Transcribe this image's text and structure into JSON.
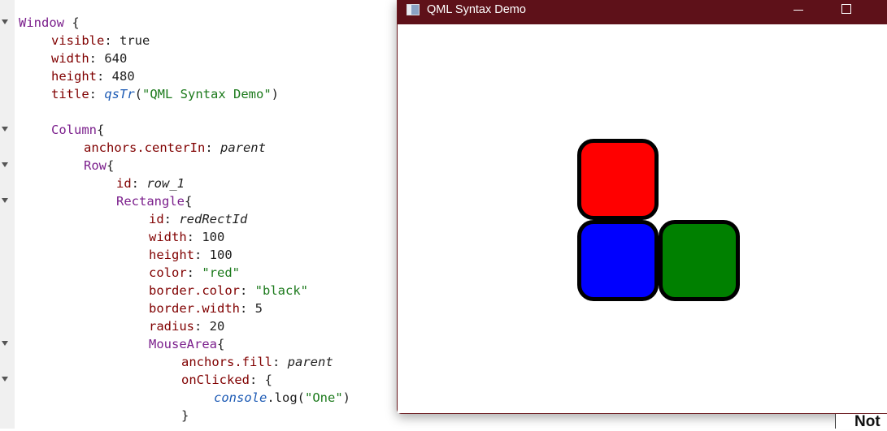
{
  "editor": {
    "lines": [
      {
        "fold": true,
        "indent": 0,
        "tokens": [
          {
            "c": "type",
            "t": "Window"
          },
          {
            "c": "plain",
            "t": " {"
          }
        ]
      },
      {
        "fold": false,
        "indent": 1,
        "tokens": [
          {
            "c": "prop",
            "t": "visible"
          },
          {
            "c": "plain",
            "t": ": true"
          }
        ]
      },
      {
        "fold": false,
        "indent": 1,
        "tokens": [
          {
            "c": "prop",
            "t": "width"
          },
          {
            "c": "plain",
            "t": ": 640"
          }
        ]
      },
      {
        "fold": false,
        "indent": 1,
        "tokens": [
          {
            "c": "prop",
            "t": "height"
          },
          {
            "c": "plain",
            "t": ": 480"
          }
        ]
      },
      {
        "fold": false,
        "indent": 1,
        "tokens": [
          {
            "c": "prop",
            "t": "title"
          },
          {
            "c": "plain",
            "t": ": "
          },
          {
            "c": "fn",
            "t": "qsTr"
          },
          {
            "c": "plain",
            "t": "("
          },
          {
            "c": "str",
            "t": "\"QML Syntax Demo\""
          },
          {
            "c": "plain",
            "t": ")"
          }
        ]
      },
      {
        "fold": false,
        "indent": 0,
        "tokens": []
      },
      {
        "fold": true,
        "indent": 1,
        "tokens": [
          {
            "c": "type",
            "t": "Column"
          },
          {
            "c": "plain",
            "t": "{"
          }
        ]
      },
      {
        "fold": false,
        "indent": 2,
        "tokens": [
          {
            "c": "prop",
            "t": "anchors.centerIn"
          },
          {
            "c": "plain",
            "t": ": "
          },
          {
            "c": "ital",
            "t": "parent"
          }
        ]
      },
      {
        "fold": true,
        "indent": 2,
        "tokens": [
          {
            "c": "type",
            "t": "Row"
          },
          {
            "c": "plain",
            "t": "{"
          }
        ]
      },
      {
        "fold": false,
        "indent": 3,
        "tokens": [
          {
            "c": "prop",
            "t": "id"
          },
          {
            "c": "plain",
            "t": ": "
          },
          {
            "c": "ital",
            "t": "row_1"
          }
        ]
      },
      {
        "fold": true,
        "indent": 3,
        "tokens": [
          {
            "c": "type",
            "t": "Rectangle"
          },
          {
            "c": "plain",
            "t": "{"
          }
        ]
      },
      {
        "fold": false,
        "indent": 4,
        "tokens": [
          {
            "c": "prop",
            "t": "id"
          },
          {
            "c": "plain",
            "t": ": "
          },
          {
            "c": "ital",
            "t": "redRectId"
          }
        ]
      },
      {
        "fold": false,
        "indent": 4,
        "tokens": [
          {
            "c": "prop",
            "t": "width"
          },
          {
            "c": "plain",
            "t": ": 100"
          }
        ]
      },
      {
        "fold": false,
        "indent": 4,
        "tokens": [
          {
            "c": "prop",
            "t": "height"
          },
          {
            "c": "plain",
            "t": ": 100"
          }
        ]
      },
      {
        "fold": false,
        "indent": 4,
        "tokens": [
          {
            "c": "prop",
            "t": "color"
          },
          {
            "c": "plain",
            "t": ": "
          },
          {
            "c": "str",
            "t": "\"red\""
          }
        ]
      },
      {
        "fold": false,
        "indent": 4,
        "tokens": [
          {
            "c": "prop",
            "t": "border.color"
          },
          {
            "c": "plain",
            "t": ": "
          },
          {
            "c": "str",
            "t": "\"black\""
          }
        ]
      },
      {
        "fold": false,
        "indent": 4,
        "tokens": [
          {
            "c": "prop",
            "t": "border.width"
          },
          {
            "c": "plain",
            "t": ": 5"
          }
        ]
      },
      {
        "fold": false,
        "indent": 4,
        "tokens": [
          {
            "c": "prop",
            "t": "radius"
          },
          {
            "c": "plain",
            "t": ": 20"
          }
        ]
      },
      {
        "fold": true,
        "indent": 4,
        "tokens": [
          {
            "c": "type",
            "t": "MouseArea"
          },
          {
            "c": "plain",
            "t": "{"
          }
        ]
      },
      {
        "fold": false,
        "indent": 5,
        "tokens": [
          {
            "c": "prop",
            "t": "anchors.fill"
          },
          {
            "c": "plain",
            "t": ": "
          },
          {
            "c": "ital",
            "t": "parent"
          }
        ]
      },
      {
        "fold": true,
        "indent": 5,
        "tokens": [
          {
            "c": "prop",
            "t": "onClicked"
          },
          {
            "c": "plain",
            "t": ": {"
          }
        ]
      },
      {
        "fold": false,
        "indent": 6,
        "tokens": [
          {
            "c": "fn",
            "t": "console"
          },
          {
            "c": "plain",
            "t": ".log("
          },
          {
            "c": "str",
            "t": "\"One\""
          },
          {
            "c": "plain",
            "t": ")"
          }
        ]
      },
      {
        "fold": false,
        "indent": 5,
        "tokens": [
          {
            "c": "plain",
            "t": "}"
          }
        ]
      }
    ]
  },
  "app_window": {
    "title": "QML Syntax Demo",
    "icon": "app-window-icon",
    "controls": {
      "minimize_icon": "minimize-icon",
      "maximize_icon": "maximize-icon"
    },
    "rectangles": [
      {
        "name": "red-rect",
        "color": "#ff0000"
      },
      {
        "name": "blue-rect",
        "color": "#0000ff"
      },
      {
        "name": "green-rect",
        "color": "#008000"
      }
    ],
    "border_color": "#000000",
    "titlebar_color": "#5e1119"
  },
  "background_app": {
    "partial_text": "Not"
  }
}
